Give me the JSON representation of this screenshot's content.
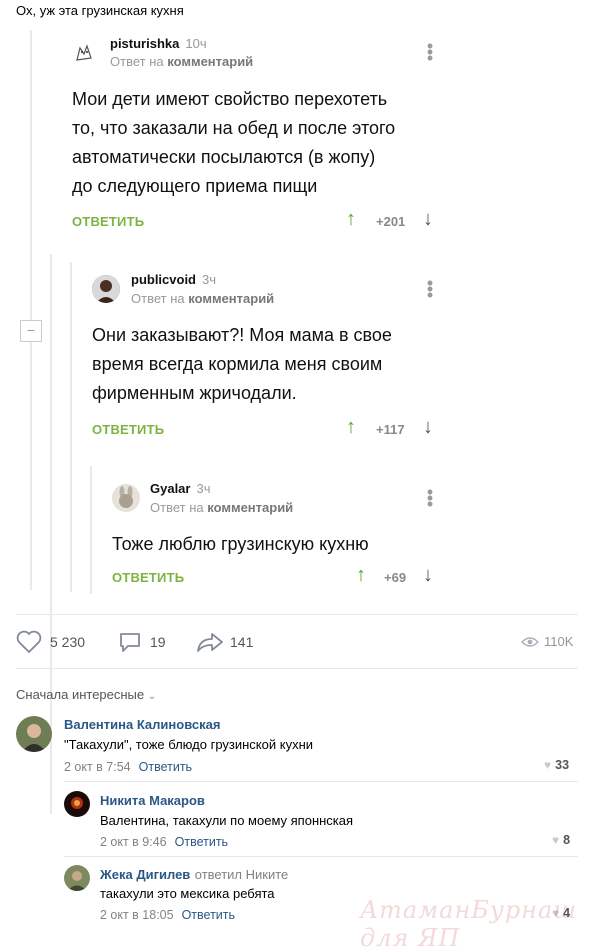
{
  "post": {
    "title": "Ох, уж эта грузинская кухня"
  },
  "comments": [
    {
      "author": "pisturishka",
      "time": "10ч",
      "reply_prefix": "Ответ на",
      "reply_target": "комментарий",
      "text_lines": [
        "Мои дети имеют свойство перехотеть",
        "то, что заказали на обед и после этого",
        "автоматически посылаются (в жопу)",
        "до следующего приема пищи"
      ],
      "reply_label": "ОТВЕТИТЬ",
      "score": "+201"
    },
    {
      "author": "publicvoid",
      "time": "3ч",
      "reply_prefix": "Ответ на",
      "reply_target": "комментарий",
      "text_lines": [
        "Они заказывают?! Моя мама в свое",
        "время всегда кормила меня своим",
        "фирменным жричодали."
      ],
      "reply_label": "ОТВЕТИТЬ",
      "score": "+117"
    },
    {
      "author": "Gyalar",
      "time": "3ч",
      "reply_prefix": "Ответ на",
      "reply_target": "комментарий",
      "text_lines": [
        "Тоже люблю грузинскую кухню"
      ],
      "reply_label": "ОТВЕТИТЬ",
      "score": "+69"
    }
  ],
  "actions": {
    "likes": "5 230",
    "comments": "19",
    "shares": "141",
    "views": "110K"
  },
  "sort": {
    "label": "Сначала интересные"
  },
  "vk_comments": [
    {
      "name": "Валентина Калиновская",
      "text": "\"Такахули\", тоже блюдо грузинской кухни",
      "date": "2 окт в 7:54",
      "answer": "Ответить",
      "likes": "33"
    },
    {
      "name": "Никита Макаров",
      "text": "Валентина, такахули по моему японнская",
      "date": "2 окт в 9:46",
      "answer": "Ответить",
      "likes": "8"
    },
    {
      "name": "Жека Дигилев",
      "replied_to": "ответил Никите",
      "text": "такахули это мексика ребята",
      "date": "2 окт в 18:05",
      "answer": "Ответить",
      "likes": "4"
    }
  ],
  "watermark": "АтаманБурнаш для ЯП",
  "colors": {
    "reply_green": "#7cb342",
    "vk_link": "#2a5885"
  }
}
